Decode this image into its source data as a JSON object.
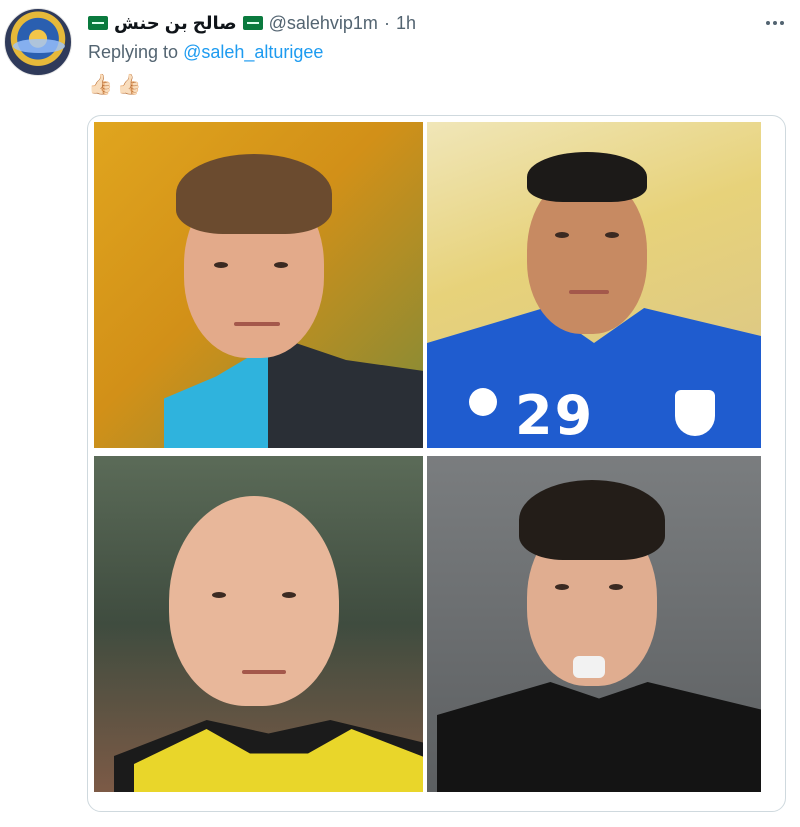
{
  "tweet": {
    "display_name": "صالح بن حنش",
    "handle": "@salehvip1m",
    "separator": "·",
    "time": "1h",
    "reply_prefix": "Replying to",
    "reply_to": "@saleh_alturigee",
    "emojis": [
      "👍🏻",
      "👍🏻"
    ],
    "flags": [
      "saudi-flag",
      "saudi-flag"
    ],
    "media": {
      "photos": [
        {
          "name": "referee-blue-collar-photo"
        },
        {
          "name": "player-blue-jersey-29-photo",
          "jersey_number": "29"
        },
        {
          "name": "referee-bald-yellow-shirt-photo"
        },
        {
          "name": "referee-whistle-black-shirt-photo"
        }
      ]
    }
  },
  "colors": {
    "link": "#1d9bf0",
    "secondary_text": "#536471",
    "border": "#cfd9de"
  }
}
